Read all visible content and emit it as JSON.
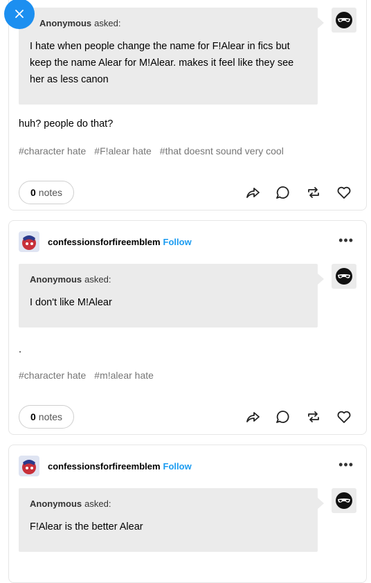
{
  "posts": [
    {
      "asker": "Anonymous",
      "asked_label": "asked:",
      "question": "I hate when people change the name for F!Alear in fics but keep the name Alear for M!Alear. makes it feel like they see her as less canon",
      "answer": "huh? people do that?",
      "tags": [
        "#character hate",
        "#F!alear hate",
        "#that doesnt sound very cool"
      ],
      "notes_count": "0",
      "notes_label": "notes"
    },
    {
      "blog_name": "confessionsforfireemblem",
      "follow_label": "Follow",
      "more": "•••",
      "asker": "Anonymous",
      "asked_label": "asked:",
      "question": "I don't like M!Alear",
      "answer": ".",
      "tags": [
        "#character hate",
        "#m!alear hate"
      ],
      "notes_count": "0",
      "notes_label": "notes"
    },
    {
      "blog_name": "confessionsforfireemblem",
      "follow_label": "Follow",
      "more": "•••",
      "asker": "Anonymous",
      "asked_label": "asked:",
      "question": "F!Alear is the better Alear"
    }
  ],
  "colors": {
    "accent": "#1b9bf0",
    "close_button": "#1c8ff0",
    "ask_bg": "#ebebeb"
  },
  "icons": [
    "close-icon",
    "share-icon",
    "reply-icon",
    "reblog-icon",
    "like-icon",
    "anonymous-sunglasses-icon",
    "more-icon"
  ]
}
